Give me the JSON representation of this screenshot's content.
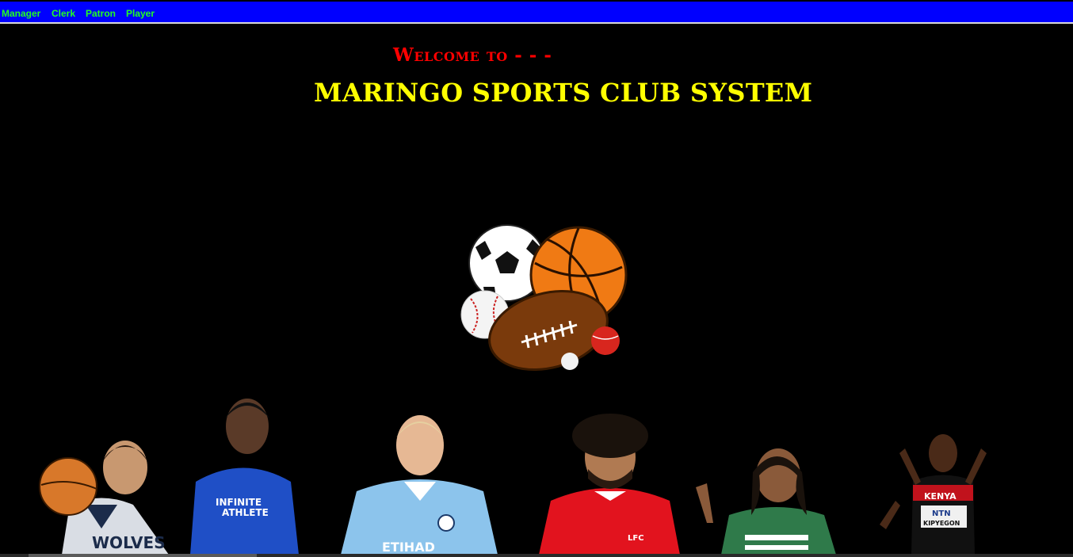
{
  "nav": {
    "items": [
      {
        "label": "Manager"
      },
      {
        "label": "Clerk"
      },
      {
        "label": "Patron"
      },
      {
        "label": "Player"
      }
    ]
  },
  "hero": {
    "welcome": "Welcome to - - -",
    "title": "MARINGO SPORTS CLUB SYSTEM"
  },
  "colors": {
    "navbar_bg": "#0000ff",
    "nav_text": "#22ff22",
    "welcome": "#ff0000",
    "title": "#ffff00",
    "page_bg": "#000000"
  },
  "images": {
    "balls": "sports-balls-icon",
    "athletes": [
      {
        "name": "basketball-player-wolves",
        "jersey_text": "WOLVES"
      },
      {
        "name": "football-player-chelsea",
        "jersey_text": "INFINITE ATHLETE"
      },
      {
        "name": "football-player-man-city",
        "jersey_text": "ETIHAD"
      },
      {
        "name": "football-player-liverpool",
        "jersey_text": "LFC"
      },
      {
        "name": "sprinter-green-top",
        "jersey_text": ""
      },
      {
        "name": "runner-kenya",
        "jersey_text": "KENYA NTN KIPYEGON"
      }
    ]
  }
}
